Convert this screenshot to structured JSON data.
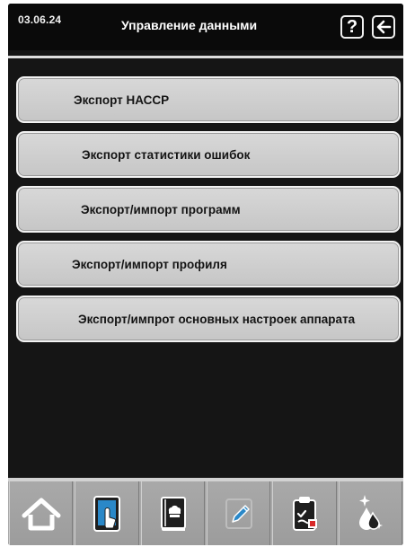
{
  "header": {
    "date": "03.06.24",
    "title": "Управление данными",
    "help_icon_label": "?",
    "back_icon": "back-arrow-icon"
  },
  "menu": {
    "items": [
      {
        "label": "Экспорт НАССР"
      },
      {
        "label": "Экспорт статистики ошибок"
      },
      {
        "label": "Экспорт/импорт программ"
      },
      {
        "label": "Экспорт/импорт профиля"
      },
      {
        "label": "Экспорт/импрот основных настроек аппарата"
      }
    ]
  },
  "footer": {
    "icons": [
      "home-icon",
      "touch-hand-icon",
      "cookbook-icon",
      "edit-pencil-icon",
      "clipboard-icon",
      "cleaning-drops-icon"
    ]
  },
  "colors": {
    "screen_background": "#151515",
    "header_background": "#0a0a0a",
    "menu_button": "#d0d0d0",
    "footer_background": "#a8a8a8",
    "icon_blue": "#2a88c8"
  }
}
